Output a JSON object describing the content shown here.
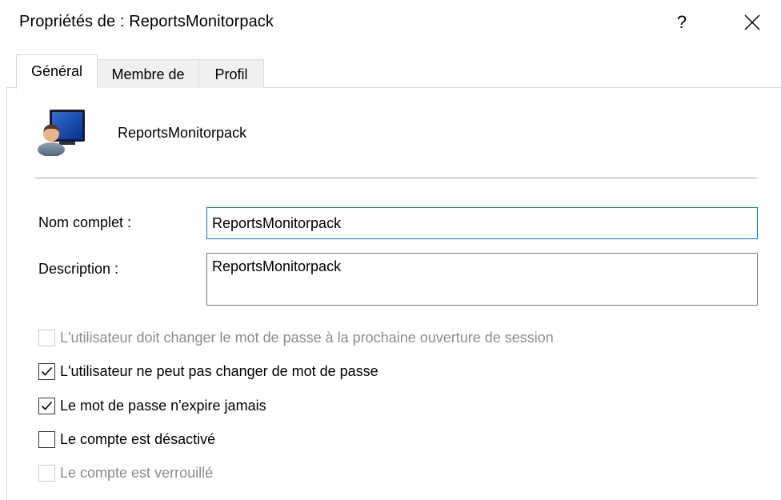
{
  "window": {
    "title": "Propriétés de : ReportsMonitorpack",
    "help_label": "?"
  },
  "tabs": [
    {
      "label": "Général",
      "active": true
    },
    {
      "label": "Membre de",
      "active": false
    },
    {
      "label": "Profil",
      "active": false
    }
  ],
  "account": {
    "icon": "user-account-icon",
    "name": "ReportsMonitorpack"
  },
  "fields": {
    "full_name": {
      "label": "Nom complet :",
      "value": "ReportsMonitorpack"
    },
    "description": {
      "label": "Description :",
      "value": "ReportsMonitorpack"
    }
  },
  "options": [
    {
      "label": "L'utilisateur doit changer le mot de passe à la prochaine ouverture de session",
      "checked": false,
      "enabled": false
    },
    {
      "label": "L'utilisateur ne peut pas changer de mot de passe",
      "checked": true,
      "enabled": true
    },
    {
      "label": "Le mot de passe n'expire jamais",
      "checked": true,
      "enabled": true
    },
    {
      "label": "Le compte est désactivé",
      "checked": false,
      "enabled": true
    },
    {
      "label": "Le compte est verrouillé",
      "checked": false,
      "enabled": false
    }
  ],
  "colors": {
    "focus_border": "#0078d7",
    "disabled_text": "#8c8c8c"
  }
}
